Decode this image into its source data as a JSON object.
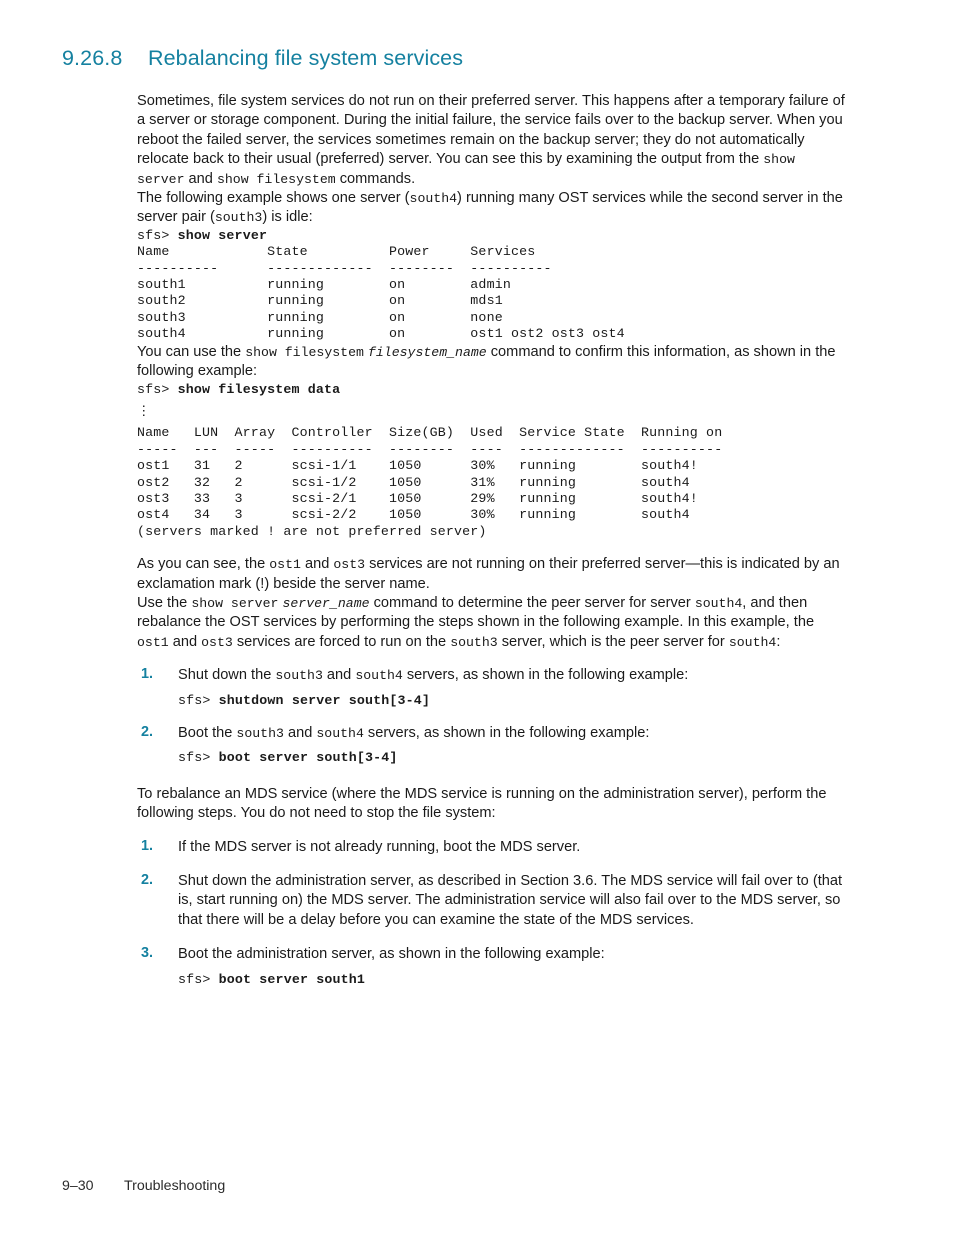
{
  "heading": {
    "number": "9.26.8",
    "title": "Rebalancing file system services"
  },
  "paragraphs": {
    "intro_1": "Sometimes, file system services do not run on their preferred server. This happens after a temporary failure of a server or storage component. During the initial failure, the service fails over to the backup server. When you reboot the failed server, the services sometimes remain on the backup server; they do not automatically relocate back to their usual (preferred) server. You can see this by examining the output from the ",
    "intro_1_code_a": "show server",
    "intro_1_mid": " and ",
    "intro_1_code_b": "show filesystem",
    "intro_1_end": " commands.",
    "intro_2_a": "The following example shows one server (",
    "intro_2_code_a": "south4",
    "intro_2_b": ") running many OST services while the second server in the server pair (",
    "intro_2_code_b": "south3",
    "intro_2_c": ") is idle:",
    "confirm_a": "You can use the ",
    "confirm_code": "show filesystem",
    "confirm_b": " ",
    "confirm_italic": "filesystem_name",
    "confirm_c": " command to confirm this information, as shown in the following example:",
    "notrunning_a": "As you can see, the ",
    "notrunning_code_a": "ost1",
    "notrunning_b": " and ",
    "notrunning_code_b": "ost3",
    "notrunning_c": " services are not running on their preferred server—this is indicated by an exclamation mark (!) beside the server name.",
    "peer_a": "Use the ",
    "peer_code_a": "show server",
    "peer_b": " ",
    "peer_italic": "server_name",
    "peer_c": " command to determine the peer server for server ",
    "peer_code_b": "south4",
    "peer_d": ", and then rebalance the OST services by performing the steps shown in the following example. In this example, the ",
    "peer_code_c": "ost1",
    "peer_e": " and ",
    "peer_code_d": "ost3",
    "peer_f": " services are forced to run on the ",
    "peer_code_e": "south3",
    "peer_g": " server, which is the peer server for ",
    "peer_code_f": "south4",
    "peer_h": ":",
    "mds_intro": "To rebalance an MDS service (where the MDS service is running on the administration server), perform the following steps. You do not need to stop the file system:"
  },
  "code_blocks": {
    "show_server_prompt": "sfs> ",
    "show_server_cmd": "show server",
    "show_server_output": "\nName            State          Power     Services\n----------      -------------  --------  ----------\nsouth1          running        on        admin\nsouth2          running        on        mds1\nsouth3          running        on        none\nsouth4          running        on        ost1 ost2 ost3 ost4",
    "show_fs_prompt": "sfs> ",
    "show_fs_cmd": "show filesystem data",
    "show_fs_ellipsis": "⋮",
    "show_fs_output": "Name   LUN  Array  Controller  Size(GB)  Used  Service State  Running on\n-----  ---  -----  ----------  --------  ----  -------------  ----------\nost1   31   2      scsi-1/1    1050      30%   running        south4!\nost2   32   2      scsi-1/2    1050      31%   running        south4\nost3   33   3      scsi-2/1    1050      29%   running        south4!\nost4   34   3      scsi-2/2    1050      30%   running        south4\n(servers marked ! are not preferred server)",
    "shutdown_prompt": "sfs> ",
    "shutdown_cmd": "shutdown server south[3-4]",
    "boot34_prompt": "sfs> ",
    "boot34_cmd": "boot server south[3-4]",
    "boot1_prompt": "sfs> ",
    "boot1_cmd": "boot server south1"
  },
  "filesystem_table": {
    "columns": [
      "Name",
      "LUN",
      "Array",
      "Controller",
      "Size(GB)",
      "Used",
      "Service State",
      "Running on"
    ],
    "rows": [
      [
        "ost1",
        "31",
        "2",
        "scsi-1/1",
        "1050",
        "30%",
        "running",
        "south4!"
      ],
      [
        "ost2",
        "32",
        "2",
        "scsi-1/2",
        "1050",
        "31%",
        "running",
        "south4"
      ],
      [
        "ost3",
        "33",
        "3",
        "scsi-2/1",
        "1050",
        "29%",
        "running",
        "south4!"
      ],
      [
        "ost4",
        "34",
        "3",
        "scsi-2/2",
        "1050",
        "30%",
        "running",
        "south4"
      ]
    ],
    "note": "(servers marked ! are not preferred server)"
  },
  "server_table": {
    "columns": [
      "Name",
      "State",
      "Power",
      "Services"
    ],
    "rows": [
      [
        "south1",
        "running",
        "on",
        "admin"
      ],
      [
        "south2",
        "running",
        "on",
        "mds1"
      ],
      [
        "south3",
        "running",
        "on",
        "none"
      ],
      [
        "south4",
        "running",
        "on",
        "ost1 ost2 ost3 ost4"
      ]
    ]
  },
  "steps_ost": {
    "item1": {
      "marker": "1.",
      "text_a": "Shut down the ",
      "code_a": "south3",
      "text_b": " and ",
      "code_b": "south4",
      "text_c": "  servers, as shown in the following example:"
    },
    "item2": {
      "marker": "2.",
      "text_a": "Boot the ",
      "code_a": "south3",
      "text_b": " and ",
      "code_b": "south4",
      "text_c": " servers, as shown in the following example:"
    }
  },
  "steps_mds": {
    "item1": {
      "marker": "1.",
      "text": "If the MDS server is not already running, boot the MDS server."
    },
    "item2": {
      "marker": "2.",
      "text": "Shut down the administration server, as described in Section 3.6. The MDS service will fail over to (that is, start running on) the MDS server. The administration service will also fail over to the MDS server, so that there will be a delay before you can examine the state of the MDS services."
    },
    "item3": {
      "marker": "3.",
      "text": "Boot the administration server, as shown in the following example:"
    }
  },
  "footer": {
    "page_number": "9–30",
    "chapter": "Troubleshooting"
  },
  "colors": {
    "heading": "#1581a0",
    "list_marker": "#1581a0",
    "body_text": "#1a1a1a",
    "background": "#ffffff"
  }
}
